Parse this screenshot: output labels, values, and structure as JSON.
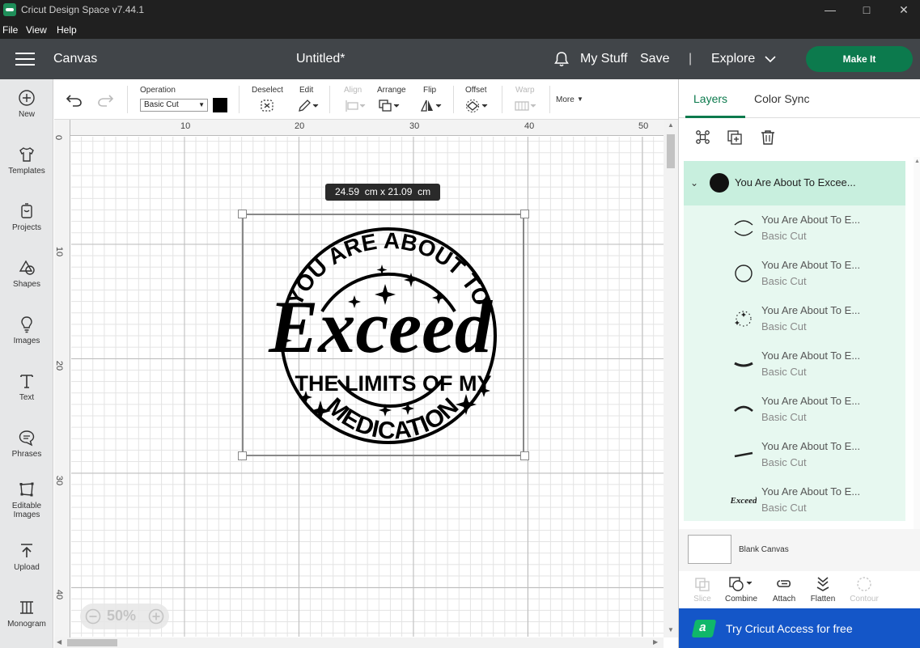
{
  "window": {
    "title": "Cricut Design Space  v7.44.1"
  },
  "menu": {
    "file": "File",
    "view": "View",
    "help": "Help"
  },
  "header": {
    "canvas_label": "Canvas",
    "doc_title": "Untitled*",
    "my_stuff": "My Stuff",
    "save": "Save",
    "separator": "|",
    "explore": "Explore",
    "make_it": "Make It"
  },
  "sidebar": {
    "items": [
      {
        "label": "New",
        "icon": "plus-circle-icon"
      },
      {
        "label": "Templates",
        "icon": "tshirt-icon"
      },
      {
        "label": "Projects",
        "icon": "projects-icon"
      },
      {
        "label": "Shapes",
        "icon": "shapes-icon"
      },
      {
        "label": "Images",
        "icon": "lightbulb-icon"
      },
      {
        "label": "Text",
        "icon": "text-icon"
      },
      {
        "label": "Phrases",
        "icon": "speech-bubble-icon"
      },
      {
        "label": "Editable",
        "label2": "Images",
        "icon": "editable-images-icon"
      },
      {
        "label": "Upload",
        "icon": "upload-icon"
      },
      {
        "label": "Monogram",
        "icon": "monogram-icon"
      }
    ]
  },
  "toolbar": {
    "operation_label": "Operation",
    "operation_value": "Basic Cut",
    "operation_color": "#000000",
    "deselect": "Deselect",
    "edit": "Edit",
    "align": "Align",
    "arrange": "Arrange",
    "flip": "Flip",
    "offset": "Offset",
    "warp": "Warp",
    "more": "More"
  },
  "canvas": {
    "ruler_top": [
      "10",
      "20",
      "30",
      "40",
      "50"
    ],
    "ruler_left": [
      "0",
      "10",
      "20",
      "30",
      "40"
    ],
    "dimensions_w": "24.59",
    "dimensions_h": "21.09",
    "dimensions_unit": "cm",
    "zoom": "50%",
    "design_text": {
      "top_arc": "YOU ARE ABOUT TO",
      "main": "Exceed",
      "middle": "THE LIMITS OF MY",
      "bottom_arc": "MEDICATION"
    }
  },
  "right_panel": {
    "tabs": [
      "Layers",
      "Color Sync"
    ],
    "active_tab": "Layers",
    "group_name": "You Are About To Excee...",
    "layers": [
      {
        "name": "You Are About To E...",
        "op": "Basic Cut",
        "icon": "arc-icon"
      },
      {
        "name": "You Are About To E...",
        "op": "Basic Cut",
        "icon": "circle-icon"
      },
      {
        "name": "You Are About To E...",
        "op": "Basic Cut",
        "icon": "stars-icon"
      },
      {
        "name": "You Are About To E...",
        "op": "Basic Cut",
        "icon": "medication-text-icon"
      },
      {
        "name": "You Are About To E...",
        "op": "Basic Cut",
        "icon": "top-arc-text-icon"
      },
      {
        "name": "You Are About To E...",
        "op": "Basic Cut",
        "icon": "limits-text-icon"
      },
      {
        "name": "You Are About To E...",
        "op": "Basic Cut",
        "icon": "exceed-script-icon"
      }
    ],
    "blank_canvas": "Blank Canvas",
    "bottom_tools": [
      "Slice",
      "Combine",
      "Attach",
      "Flatten",
      "Contour"
    ],
    "access_banner": "Try Cricut Access for free"
  },
  "colors": {
    "accent": "#0c7a4d",
    "header": "#414549",
    "access_blue": "#1456c8",
    "layer_highlight": "#c8efde"
  }
}
